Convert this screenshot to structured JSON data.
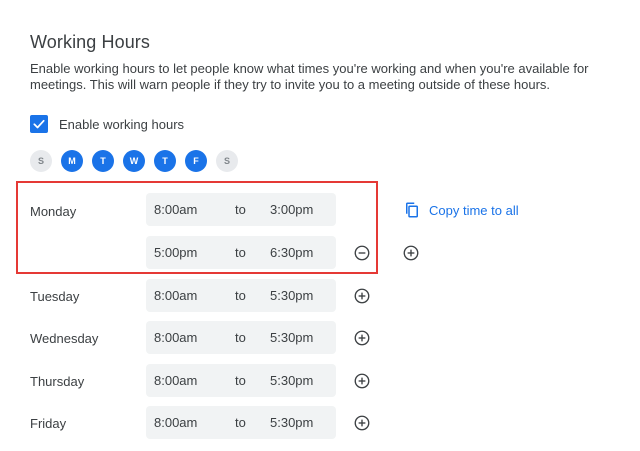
{
  "section": {
    "title": "Working Hours",
    "description": "Enable working hours to let people know what times you're working and when you're available for meetings. This will warn people if they try to invite you to a meeting outside of these hours."
  },
  "enable": {
    "label": "Enable working hours",
    "checked": true
  },
  "days": [
    {
      "letter": "S",
      "selected": false
    },
    {
      "letter": "M",
      "selected": true
    },
    {
      "letter": "T",
      "selected": true
    },
    {
      "letter": "W",
      "selected": true
    },
    {
      "letter": "T",
      "selected": true
    },
    {
      "letter": "F",
      "selected": true
    },
    {
      "letter": "S",
      "selected": false
    }
  ],
  "schedule": {
    "to_label": "to",
    "monday": {
      "label": "Monday",
      "slots": [
        {
          "start": "8:00am",
          "end": "3:00pm"
        },
        {
          "start": "5:00pm",
          "end": "6:30pm"
        }
      ]
    },
    "tuesday": {
      "label": "Tuesday",
      "start": "8:00am",
      "end": "5:30pm"
    },
    "wednesday": {
      "label": "Wednesday",
      "start": "8:00am",
      "end": "5:30pm"
    },
    "thursday": {
      "label": "Thursday",
      "start": "8:00am",
      "end": "5:30pm"
    },
    "friday": {
      "label": "Friday",
      "start": "8:00am",
      "end": "5:30pm"
    }
  },
  "copy_link": {
    "label": "Copy time to all",
    "icon": "copy-icon"
  },
  "colors": {
    "accent": "#1a73e8",
    "highlight": "#e53935",
    "field_bg": "#f1f3f4"
  }
}
